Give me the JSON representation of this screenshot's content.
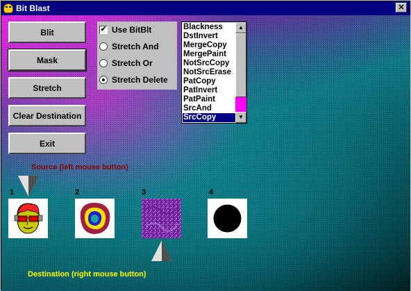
{
  "window": {
    "title": "Bit Blast",
    "close_glyph": "✕"
  },
  "buttons": [
    {
      "label": "Blit"
    },
    {
      "label": "Mask"
    },
    {
      "label": "Stretch"
    },
    {
      "label": "Clear Destination"
    },
    {
      "label": "Exit"
    }
  ],
  "options": {
    "use_bitblt": {
      "label": "Use BitBlt",
      "checked": true,
      "check_glyph": "✔"
    },
    "radios": [
      {
        "label": "Stretch And",
        "selected": false
      },
      {
        "label": "Stretch Or",
        "selected": false
      },
      {
        "label": "Stretch Delete",
        "selected": true
      }
    ]
  },
  "raster_ops": {
    "items": [
      "Blackness",
      "DstInvert",
      "MergeCopy",
      "MergePaint",
      "NotSrcCopy",
      "NotSrcErase",
      "PatCopy",
      "PatInvert",
      "PatPaint",
      "SrcAnd",
      "SrcCopy"
    ],
    "selected": "SrcCopy",
    "scroll_up_glyph": "▲",
    "scroll_down_glyph": "▼"
  },
  "labels": {
    "source": "Source (left mouse button)",
    "destination": "Destination (right mouse button)"
  },
  "tiles": [
    {
      "number": "1",
      "content": "face-with-sunglasses"
    },
    {
      "number": "2",
      "content": "concentric-rings"
    },
    {
      "number": "3",
      "content": "purple-noise-texture"
    },
    {
      "number": "4",
      "content": "black-circle"
    }
  ],
  "colors": {
    "titlebar": "#000080",
    "selection": "#000080",
    "source_label": "#8a0000",
    "destination_label": "#ffff00",
    "scrollbar_track": "#ff00ff"
  }
}
